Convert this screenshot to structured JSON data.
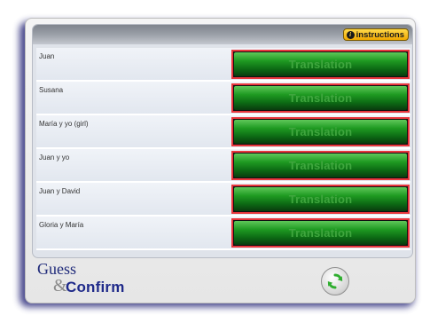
{
  "toolbar": {
    "instructions_label": "instructions",
    "info_glyph": "i"
  },
  "rows": [
    {
      "label": "Juan",
      "button_label": "Translation"
    },
    {
      "label": "Susana",
      "button_label": "Translation"
    },
    {
      "label": "María y yo (girl)",
      "button_label": "Translation"
    },
    {
      "label": "Juan y yo",
      "button_label": "Translation"
    },
    {
      "label": "Juan y David",
      "button_label": "Translation"
    },
    {
      "label": "Gloria y María",
      "button_label": "Translation"
    }
  ],
  "logo": {
    "guess": "Guess",
    "amp": "&",
    "confirm": "Confirm"
  },
  "icons": {
    "refresh": "refresh-icon",
    "info": "info-icon"
  },
  "colors": {
    "button_green": "#1f9b22",
    "row_highlight_border": "#e8373d",
    "instructions_gold": "#f0a800",
    "logo_blue": "#1f2a7a"
  }
}
